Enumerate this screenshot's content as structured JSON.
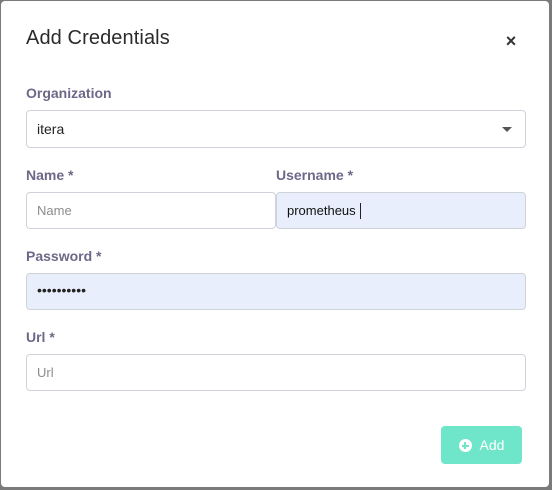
{
  "modal": {
    "title": "Add Credentials",
    "close_label": "×"
  },
  "organization": {
    "label": "Organization",
    "selected": "itera"
  },
  "name": {
    "label": "Name *",
    "placeholder": "Name",
    "value": ""
  },
  "username": {
    "label": "Username *",
    "value": "prometheus"
  },
  "password": {
    "label": "Password *",
    "masked_value": "••••••••••"
  },
  "url": {
    "label": "Url *",
    "placeholder": "Url",
    "value": ""
  },
  "actions": {
    "add_label": "Add"
  },
  "colors": {
    "accent": "#6fe6c9",
    "label": "#6f6788",
    "autofill": "#e8eefc"
  }
}
